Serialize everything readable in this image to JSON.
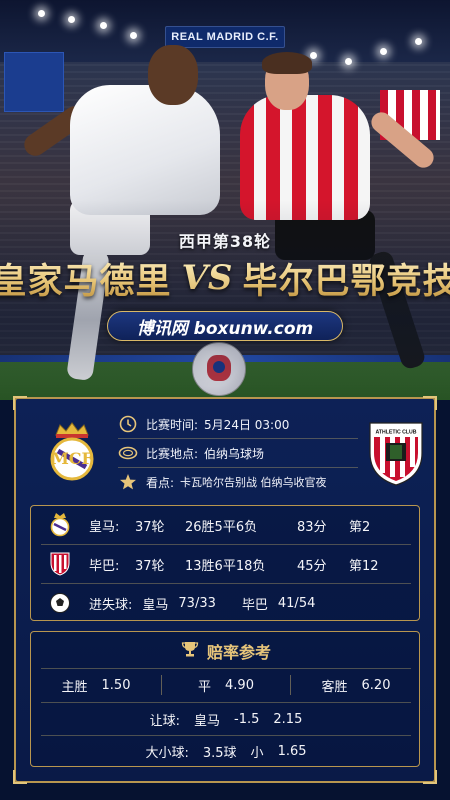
{
  "stadium_sign": "REAL MADRID C.F.",
  "headline": {
    "round": "西甲第38轮",
    "home_team": "皇家马德里",
    "vs": "VS",
    "away_team": "毕尔巴鄂竞技",
    "site": "博讯网 boxunw.com"
  },
  "match": {
    "time_label": "比赛时间:",
    "time_value": "5月24日 03:00",
    "venue_label": "比赛地点:",
    "venue_value": "伯纳乌球场",
    "highlight_label": "看点:",
    "highlight_value": "卡瓦哈尔告别战 伯纳乌收官夜",
    "away_crest_text": "ATHLETIC CLUB"
  },
  "standings": [
    {
      "team": "皇马:",
      "rounds": "37轮",
      "record": "26胜5平6负",
      "points": "83分",
      "rank": "第2"
    },
    {
      "team": "毕巴:",
      "rounds": "37轮",
      "record": "13胜6平18负",
      "points": "45分",
      "rank": "第12"
    }
  ],
  "goals": {
    "label": "进失球:",
    "home_name": "皇马",
    "home_value": "73/33",
    "away_name": "毕巴",
    "away_value": "41/54"
  },
  "odds": {
    "title": "赔率参考",
    "win_label": "主胜",
    "win_value": "1.50",
    "draw_label": "平",
    "draw_value": "4.90",
    "loss_label": "客胜",
    "loss_value": "6.20",
    "handicap_label": "让球:",
    "handicap_team": "皇马",
    "handicap_line": "-1.5",
    "handicap_value": "2.15",
    "total_label": "大小球:",
    "total_line": "3.5球",
    "total_side": "小",
    "total_value": "1.65"
  },
  "colors": {
    "gold": "#e7c57a",
    "panel_bg": "#0d2156",
    "frame": "#b8964f"
  }
}
